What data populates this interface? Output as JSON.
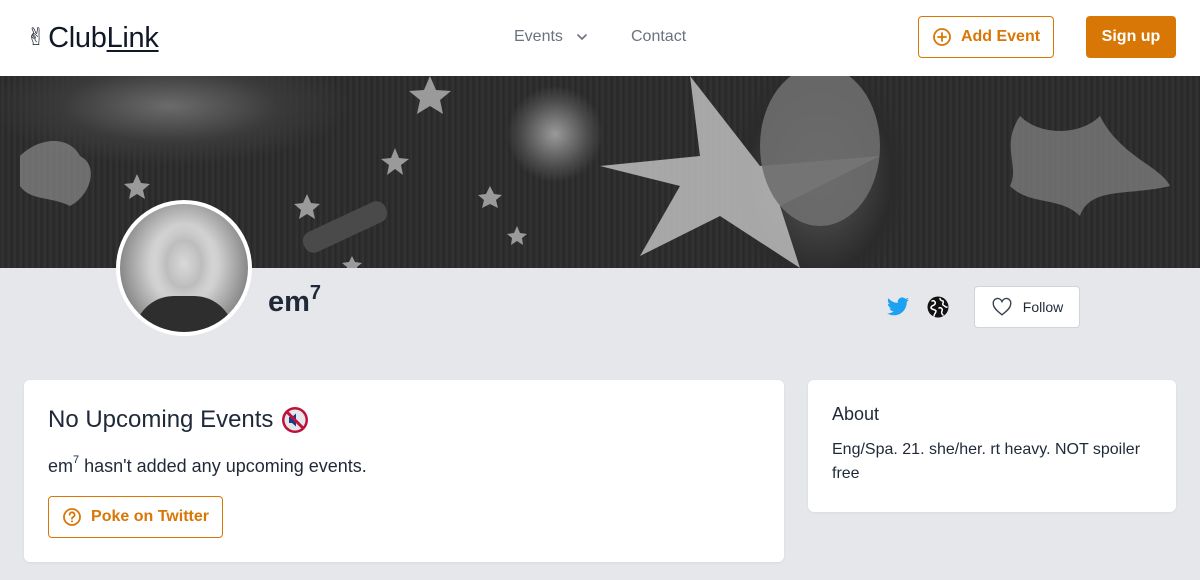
{
  "header": {
    "logo_icon": "✌",
    "logo_club": "Club",
    "logo_link": "Link",
    "nav": {
      "events_label": "Events",
      "contact_label": "Contact"
    },
    "add_event_label": "Add Event",
    "sign_up_label": "Sign up"
  },
  "profile": {
    "name": "em",
    "name_sup": "7",
    "follow_label": "Follow"
  },
  "events_card": {
    "title": "No Upcoming Events",
    "title_icon": "muted-speaker-icon",
    "message_name": "em",
    "message_sup": "7",
    "message_rest": " hasn't added any upcoming events.",
    "poke_label": "Poke on Twitter"
  },
  "about_card": {
    "title": "About",
    "text": "Eng/Spa. 21. she/her. rt heavy. NOT spoiler free"
  },
  "colors": {
    "accent": "#d97706",
    "twitter": "#1da1f2",
    "page_bg": "#e5e7eb"
  }
}
